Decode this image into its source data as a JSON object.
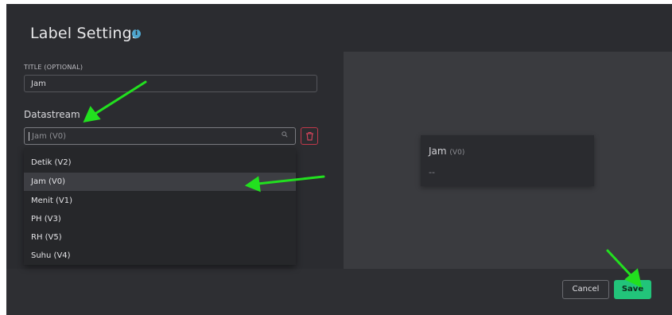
{
  "dialog": {
    "title": "Label Settings",
    "info_icon": "info-icon"
  },
  "form": {
    "title_field_label": "TITLE (OPTIONAL)",
    "title_value": "Jam",
    "datastream_label": "Datastream",
    "datastream_selected": "Jam (V0)",
    "datastream_options": [
      {
        "label": "Detik (V2)",
        "selected": false
      },
      {
        "label": "Jam (V0)",
        "selected": true
      },
      {
        "label": "Menit (V1)",
        "selected": false
      },
      {
        "label": "PH (V3)",
        "selected": false
      },
      {
        "label": "RH (V5)",
        "selected": false
      },
      {
        "label": "Suhu (V4)",
        "selected": false
      }
    ]
  },
  "preview": {
    "widget_title": "Jam",
    "widget_datastream": "(V0)",
    "widget_value": "--"
  },
  "footer": {
    "cancel_label": "Cancel",
    "save_label": "Save"
  },
  "colors": {
    "accent": "#22c47a",
    "danger": "#c0394b",
    "annotation_arrow": "#22e01f"
  }
}
